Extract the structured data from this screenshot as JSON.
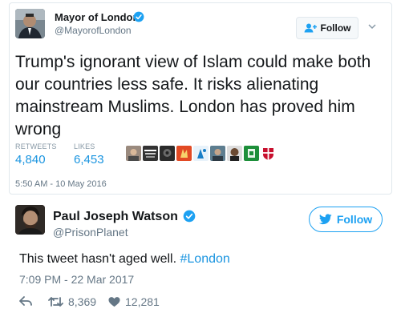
{
  "quoted_tweet": {
    "author_name": "Mayor of London",
    "author_handle": "@MayorofLondon",
    "follow_label": "Follow",
    "text": "Trump's ignorant view of Islam could make both our countries less safe. It risks alienating mainstream Muslims. London has proved him wrong",
    "stats": [
      {
        "label": "RETWEETS",
        "value": "4,840"
      },
      {
        "label": "LIKES",
        "value": "6,453"
      }
    ],
    "liker_avatars": [
      "face-1",
      "face-2",
      "face-3",
      "face-4",
      "face-5",
      "face-6",
      "face-7",
      "face-8",
      "face-9"
    ],
    "timestamp": "5:50 AM - 10 May 2016"
  },
  "reply_tweet": {
    "author_name": "Paul Joseph Watson",
    "author_handle": "@PrisonPlanet",
    "follow_label": "Follow",
    "text_prefix": "This tweet hasn't aged well. ",
    "hashtag": "#London",
    "timestamp": "7:09 PM - 22 Mar 2017",
    "retweet_count": "8,369",
    "like_count": "12,281"
  },
  "colors": {
    "accent": "#1da1f2",
    "link": "#1b95e0",
    "muted": "#657786",
    "verified": "#1da1f2"
  }
}
